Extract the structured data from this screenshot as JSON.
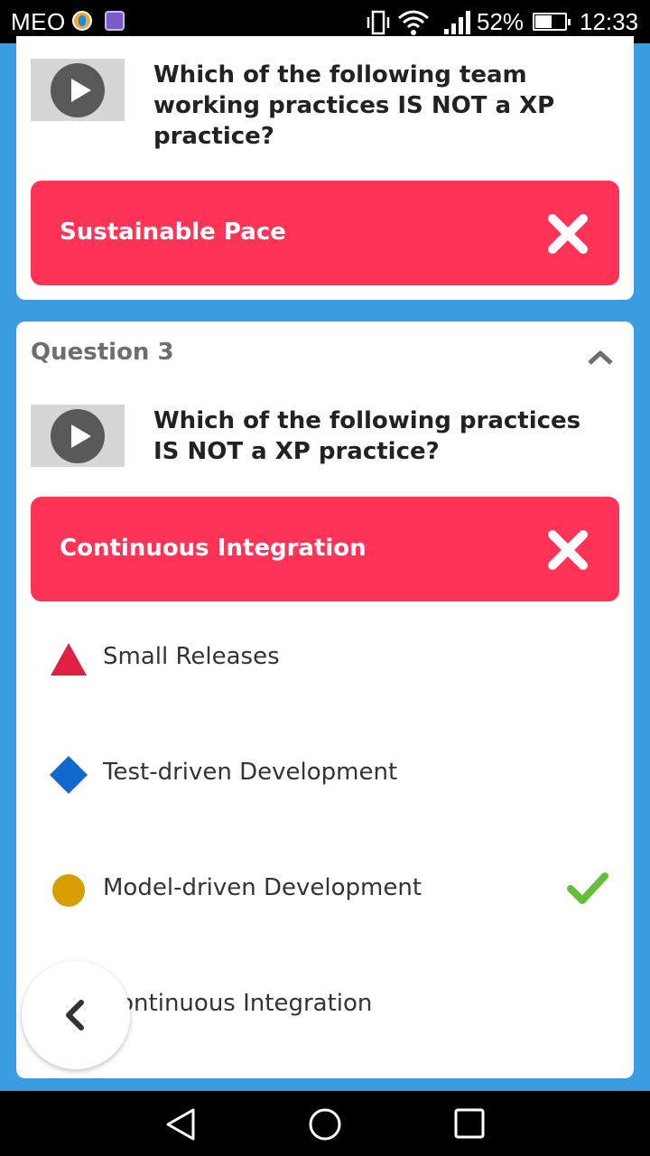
{
  "status_bar": {
    "carrier": "MEO",
    "battery_percent": "52%",
    "time": "12:33",
    "icons": [
      "vibrate-icon",
      "wifi-icon",
      "signal-icon",
      "battery-icon"
    ]
  },
  "card_1": {
    "question": "Which of the following team working practices IS NOT a XP practice?",
    "selected_answer": "Sustainable Pace",
    "result": "incorrect"
  },
  "card_2": {
    "label": "Question 3",
    "question": "Which of the following practices IS NOT a XP practice?",
    "selected_answer": "Continuous Integration",
    "result": "incorrect",
    "options": [
      {
        "text": "Small Releases",
        "shape": "triangle",
        "color": "#e0203f",
        "correct": false
      },
      {
        "text": "Test-driven Development",
        "shape": "diamond",
        "color": "#1368ce",
        "correct": false
      },
      {
        "text": "Model-driven Development",
        "shape": "circle",
        "color": "#d89e00",
        "correct": true
      },
      {
        "text": "Continuous Integration",
        "shape": "square",
        "color": "#26890c",
        "correct": false
      }
    ]
  },
  "colors": {
    "background": "#3c9ce0",
    "wrong_answer": "#ff3355",
    "check": "#66bf39"
  }
}
